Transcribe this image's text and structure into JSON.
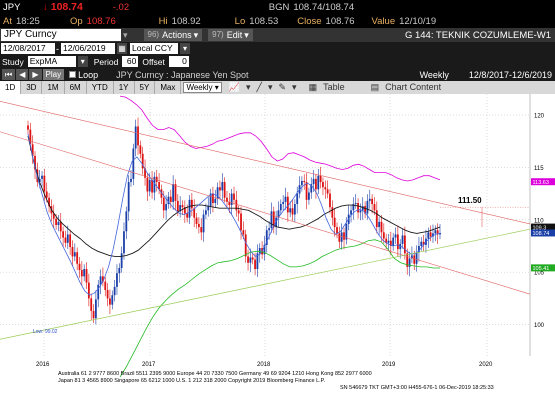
{
  "quote": {
    "symbol": "JPY",
    "last": "108.74",
    "change": "-.02",
    "bgn_label": "BGN",
    "bgn_value": "108.74/108.74",
    "at_label": "At",
    "at_time": "18:25",
    "op_label": "Op",
    "op_value": "108.76",
    "hi_label": "Hi",
    "hi_value": "108.92",
    "lo_label": "Lo",
    "lo_value": "108.53",
    "close_label": "Close",
    "close_value": "108.76",
    "value_label": "Value",
    "value_date": "12/10/19"
  },
  "toolbar": {
    "security": "JPY Curncy",
    "actions_num": "96)",
    "actions_label": "Actions",
    "edit_num": "97)",
    "edit_label": "Edit",
    "launchpad": "G 144: TEKNIK COZUMLEME-W1"
  },
  "range": {
    "start": "12/08/2017",
    "end": "12/06/2019",
    "currency": "Local CCY"
  },
  "study": {
    "study_label": "Study",
    "study_value": "ExpMA",
    "period_label": "Period",
    "period_value": "60",
    "offset_label": "Offset",
    "offset_value": "0"
  },
  "controls": {
    "play_label": "Play",
    "loop_label": "Loop",
    "chart_title": "JPY  Curncy : Japanese Yen Spot",
    "frequency": "Weekly",
    "date_range": "12/8/2017-12/6/2019"
  },
  "periods": [
    "1D",
    "3D",
    "1M",
    "6M",
    "YTD",
    "1Y",
    "5Y",
    "Max"
  ],
  "period_dropdown": "Weekly",
  "tools": {
    "table_label": "Table",
    "chart_content_label": "Chart Content"
  },
  "chart_data": {
    "type": "candlestick",
    "x_tick_labels": [
      "2016",
      "2017",
      "2018",
      "2019",
      "2020"
    ],
    "y_tick_labels": [
      "100",
      "105",
      "110",
      "115",
      "120"
    ],
    "ylim": [
      97,
      122
    ],
    "annotation": "111.50",
    "low_label": "Low: 99.02",
    "right_labels": [
      {
        "value": "113.63",
        "color": "#dd00dd"
      },
      {
        "value": "109.3",
        "color": "#111111"
      },
      {
        "value": "108.74",
        "color": "#1a3fa8"
      },
      {
        "value": "105.41",
        "color": "#22aa22"
      }
    ],
    "price_series": [
      118.6,
      117.2,
      116.1,
      114.8,
      113.6,
      113.9,
      114.2,
      112.7,
      112.1,
      111.3,
      110.6,
      110.1,
      109.5,
      109.8,
      108.9,
      108.3,
      107.8,
      108.6,
      107.4,
      106.5,
      106.9,
      105.8,
      105.2,
      104.6,
      105.3,
      104.0,
      102.5,
      101.3,
      100.6,
      102.4,
      103.8,
      104.6,
      104.1,
      103.3,
      102.5,
      101.9,
      102.8,
      103.6,
      104.9,
      105.4,
      106.8,
      108.9,
      110.8,
      113.6,
      113.9,
      116.8,
      118.9,
      117.1,
      116.3,
      114.9,
      114.0,
      112.7,
      113.8,
      112.6,
      114.1,
      113.6,
      112.9,
      112.1,
      110.9,
      111.5,
      112.2,
      111.7,
      113.4,
      111.8,
      110.8,
      111.4,
      111.2,
      110.6,
      110.2,
      111.9,
      111.1,
      110.2,
      109.6,
      109.3,
      108.8,
      110.5,
      110.9,
      111.3,
      112.5,
      111.6,
      112.0,
      113.1,
      112.8,
      113.6,
      112.1,
      111.7,
      111.4,
      112.5,
      111.9,
      110.9,
      110.6,
      109.0,
      108.6,
      106.5,
      105.9,
      106.4,
      106.2,
      105.3,
      106.8,
      107.3,
      106.7,
      107.6,
      109.0,
      109.2,
      110.8,
      109.3,
      110.2,
      110.9,
      111.5,
      111.7,
      112.2,
      110.7,
      111.1,
      110.5,
      111.5,
      112.5,
      113.3,
      113.7,
      113.6,
      111.9,
      112.6,
      113.4,
      113.9,
      112.9,
      114.2,
      113.6,
      113.1,
      112.9,
      112.5,
      111.2,
      110.2,
      109.3,
      108.7,
      107.9,
      108.8,
      108.1,
      109.6,
      110.5,
      110.9,
      111.5,
      111.6,
      110.7,
      110.9,
      111.3,
      110.6,
      111.8,
      112.0,
      111.5,
      110.9,
      109.3,
      109.8,
      108.8,
      108.2,
      107.8,
      108.0,
      107.5,
      108.3,
      108.6,
      107.2,
      107.7,
      108.5,
      106.8,
      105.5,
      106.3,
      106.6,
      105.8,
      106.9,
      107.5,
      107.9,
      107.6,
      108.2,
      108.8,
      108.4,
      108.7,
      109.0,
      108.6,
      108.74
    ],
    "series": [
      {
        "name": "EMA60",
        "color": "#1a1a1a",
        "values": [
          118.0,
          115.5,
          113.6,
          112.2,
          111.0,
          110.2,
          109.6,
          109.1,
          108.6,
          108.2,
          107.7,
          107.3,
          107.0,
          106.8,
          106.6,
          106.5,
          106.5,
          106.6,
          106.8,
          107.1,
          107.6,
          108.1,
          108.7,
          109.3,
          109.9,
          110.4,
          110.8,
          111.1,
          111.3,
          111.4,
          111.4,
          111.3,
          111.2,
          111.1,
          111.1,
          111.1,
          111.1,
          111.0,
          110.9,
          110.6,
          110.3,
          109.9,
          109.6,
          109.3,
          109.2,
          109.1,
          109.2,
          109.3,
          109.5,
          109.8,
          110.1,
          110.5,
          110.8,
          111.1,
          111.3,
          111.4,
          111.4,
          111.3,
          111.1,
          110.9,
          110.6,
          110.2,
          109.9,
          109.6,
          109.3,
          109.0,
          108.8,
          108.7,
          108.8,
          108.9,
          109.1,
          109.3
        ]
      },
      {
        "name": "EMA-fast",
        "color": "#4466dd",
        "values": [
          118.2,
          116.0,
          114.0,
          112.4,
          110.8,
          109.6,
          108.7,
          107.8,
          106.9,
          106.0,
          105.0,
          104.0,
          103.2,
          102.8,
          103.0,
          103.5,
          104.3,
          105.5,
          107.2,
          109.5,
          112.0,
          114.2,
          115.6,
          116.0,
          115.4,
          114.6,
          113.9,
          113.3,
          112.7,
          112.1,
          111.5,
          111.0,
          110.6,
          110.5,
          110.7,
          111.0,
          111.4,
          111.8,
          112.2,
          112.5,
          112.3,
          111.8,
          111.2,
          110.5,
          109.7,
          108.8,
          107.8,
          107.0,
          106.5,
          106.7,
          107.5,
          108.5,
          109.5,
          110.3,
          110.9,
          111.4,
          112.0,
          112.7,
          113.2,
          113.5,
          113.2,
          112.5,
          111.4,
          110.1,
          109.1,
          108.6,
          108.9,
          109.6,
          110.3,
          110.8,
          111.0,
          110.8,
          110.2,
          109.4,
          108.6,
          108.0,
          107.7,
          107.5,
          107.6,
          107.4,
          107.0,
          106.7,
          106.8,
          107.3,
          107.9,
          108.3,
          108.6,
          108.7
        ]
      },
      {
        "name": "MA-upper",
        "color": "#dd00dd",
        "values": [
          121.8,
          121.7,
          121.4,
          121.0,
          120.5,
          119.7,
          119.0,
          118.6,
          118.6,
          118.8,
          118.6,
          118.0,
          117.4,
          117.0,
          116.8,
          116.9,
          117.0,
          117.2,
          117.5,
          117.6,
          117.8,
          118.0,
          118.2,
          118.3,
          118.3,
          118.0,
          117.5,
          116.8,
          116.0,
          115.6,
          115.8,
          116.3,
          116.4,
          116.2,
          116.0,
          115.7,
          115.5,
          115.4,
          115.3,
          115.1,
          114.9,
          114.8,
          114.9,
          115.2,
          115.3,
          115.1,
          114.8,
          114.5,
          114.5,
          114.5,
          114.3,
          114.0,
          113.8,
          113.7,
          113.8,
          114.0,
          114.2,
          114.2,
          114.0,
          113.8
        ]
      },
      {
        "name": "MA-lower",
        "color": "#22bb22",
        "values": [
          95.0,
          96.0,
          97.2,
          98.4,
          99.6,
          100.7,
          101.6,
          102.3,
          102.9,
          103.4,
          103.8,
          104.3,
          104.8,
          105.2,
          105.6,
          105.9,
          106.0,
          106.1,
          106.3,
          106.6,
          106.9,
          107.0,
          106.9,
          106.6,
          106.2,
          105.8,
          105.5,
          105.5,
          105.6,
          105.8,
          106.1,
          106.5,
          106.8,
          107.1,
          107.3,
          107.4,
          107.5,
          107.7,
          108.0,
          108.1,
          107.9,
          107.2,
          106.3,
          105.9,
          105.7,
          105.6,
          105.5,
          105.5,
          105.4,
          105.4
        ]
      }
    ]
  },
  "footer": {
    "line1": "Australia 61 2 9777 8600 Brazil 5511 2395 9000 Europe 44 20 7330 7500 Germany 49 69 9204 1210 Hong Kong 852 2977 6000",
    "line2": "Japan 81 3 4565 8900        Singapore 65 6212 1000        U.S. 1 212 318 2000        Copyright 2019 Bloomberg Finance L.P.",
    "line3": "SN 546679 TKT  GMT+3:00 H455-676-1 06-Dec-2019 18:25:33"
  }
}
